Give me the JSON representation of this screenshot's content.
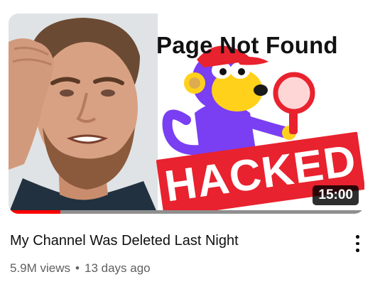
{
  "video": {
    "thumbnail": {
      "headline": "Page Not Found",
      "banner": "HACKED",
      "duration": "15:00",
      "watch_progress_fraction": 0.145
    },
    "title": "My Channel Was Deleted Last Night",
    "views": "5.9M views",
    "separator": "•",
    "age": "13 days ago",
    "menu_icon": "more-vertical-icon"
  },
  "colors": {
    "progress_fill": "#ff0000",
    "progress_track": "#8f8f8f",
    "banner": "#e8222e",
    "monkey_body": "#7a3ef3",
    "monkey_face": "#ffd11a",
    "cap": "#e8222e",
    "magnifier": "#e8222e"
  }
}
